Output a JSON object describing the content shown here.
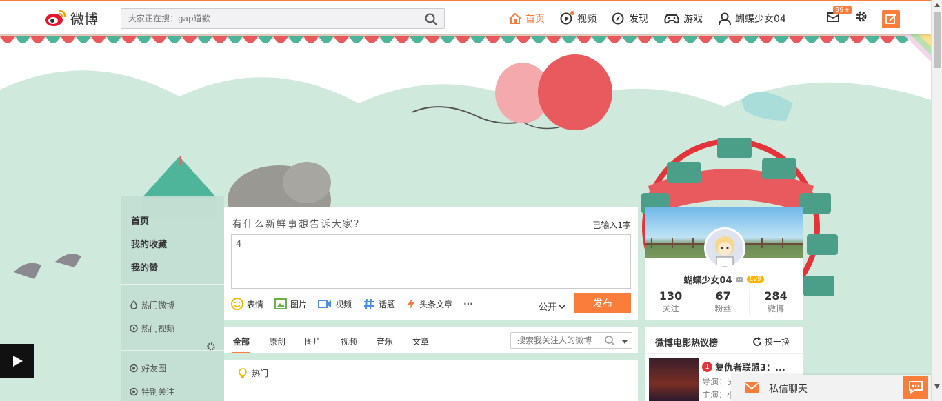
{
  "topbar": {
    "logo_text": "微博",
    "search_placeholder": "大家正在搜：gap道歉",
    "nav": [
      {
        "label": "首页",
        "icon": "home-icon",
        "active": true
      },
      {
        "label": "视频",
        "icon": "video-play-icon",
        "active": false
      },
      {
        "label": "发现",
        "icon": "compass-icon",
        "active": false
      },
      {
        "label": "游戏",
        "icon": "gamepad-icon",
        "active": false
      },
      {
        "label": "蝴蝶少女04",
        "icon": "user-icon",
        "active": false
      }
    ],
    "message_badge": "99+",
    "accent_color": "#fa7d3c"
  },
  "left_nav": {
    "main_items": [
      "首页",
      "我的收藏",
      "我的赞"
    ],
    "hot_items": [
      "热门微博",
      "热门视频"
    ],
    "group_items": [
      "好友圈",
      "特别关注"
    ]
  },
  "publisher": {
    "title": "有什么新鲜事想告诉大家？",
    "char_count": "已输入1字",
    "content": "4",
    "tools": [
      "表情",
      "图片",
      "视频",
      "话题",
      "头条文章"
    ],
    "more": "···",
    "visibility": "公开",
    "send_label": "发布"
  },
  "feed_tabs": {
    "tabs": [
      "全部",
      "原创",
      "图片",
      "视频",
      "音乐",
      "文章"
    ],
    "active": "全部",
    "search_placeholder": "搜索我关注人的微博"
  },
  "hot_section": {
    "label": "热门"
  },
  "profile": {
    "name": "蝴蝶少女04",
    "level": "Lv9",
    "stats": [
      {
        "value": "130",
        "label": "关注"
      },
      {
        "value": "67",
        "label": "粉丝"
      },
      {
        "value": "284",
        "label": "微博"
      }
    ]
  },
  "movies": {
    "title": "微博电影热议榜",
    "change_label": "换一换",
    "top_item": {
      "rank": "1",
      "name": "复仇者联盟3：...",
      "director": "导演：罗",
      "cast": "主演：小"
    }
  },
  "chat": {
    "label": "私信聊天"
  }
}
